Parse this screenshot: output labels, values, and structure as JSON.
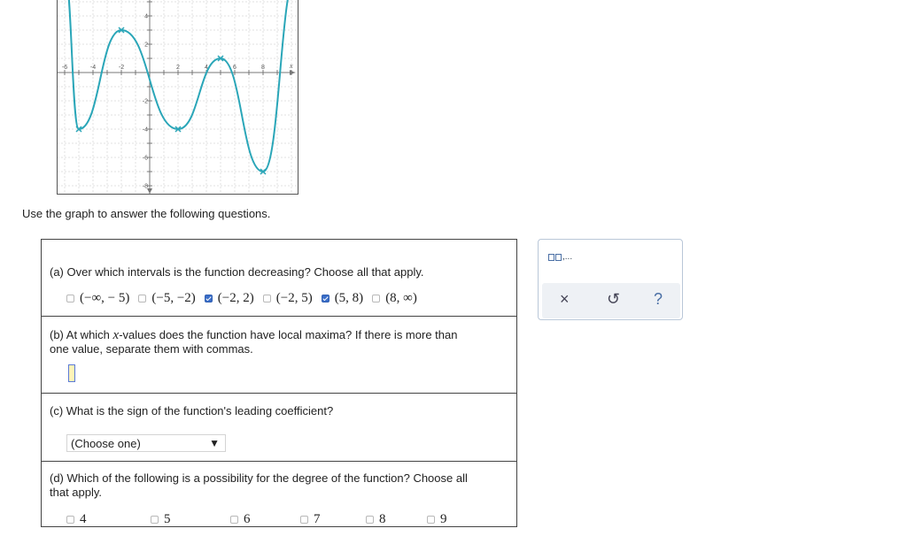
{
  "graph": {
    "x_tick_labels": [
      "-6",
      "-4",
      "-2",
      "2",
      "4",
      "6",
      "8"
    ],
    "y_tick_labels": [
      "4",
      "2",
      "-2",
      "-4",
      "-6",
      "-8"
    ],
    "x_axis_label": "x",
    "curve_color": "#2aa6b8",
    "marked_points": [
      {
        "x": -5,
        "y": -4
      },
      {
        "x": -2,
        "y": 3
      },
      {
        "x": 2,
        "y": -4
      },
      {
        "x": 5,
        "y": 1
      },
      {
        "x": 8,
        "y": -7
      }
    ]
  },
  "instruction": "Use the graph to answer the following questions.",
  "question_a": {
    "prompt": "(a) Over which intervals is the function decreasing? Choose all that apply.",
    "options": [
      {
        "label": "(−∞, − 5)",
        "checked": false
      },
      {
        "label": "(−5, −2)",
        "checked": false
      },
      {
        "label": "(−2, 2)",
        "checked": true
      },
      {
        "label": "(−2, 5)",
        "checked": false
      },
      {
        "label": "(5, 8)",
        "checked": true
      },
      {
        "label": "(8, ∞)",
        "checked": false
      }
    ]
  },
  "question_b": {
    "prompt_line1_pre": "(b) At which ",
    "var": "x",
    "prompt_line1_post": "-values does the function have local maxima? If there is more than",
    "prompt_line2": "one value, separate them with commas.",
    "input_value": ""
  },
  "question_c": {
    "prompt": "(c) What is the sign of the function's leading coefficient?",
    "select_value": "(Choose one)",
    "arrow": "▼"
  },
  "question_d": {
    "prompt_line1": "(d) Which of the following is a possibility for the degree of the function? Choose all",
    "prompt_line2": "that apply.",
    "options": [
      "4",
      "5",
      "6",
      "7",
      "8",
      "9"
    ]
  },
  "toolbox": {
    "interval_suffix": ",...",
    "close_label": "×",
    "undo_label": "↺",
    "help_label": "?"
  }
}
